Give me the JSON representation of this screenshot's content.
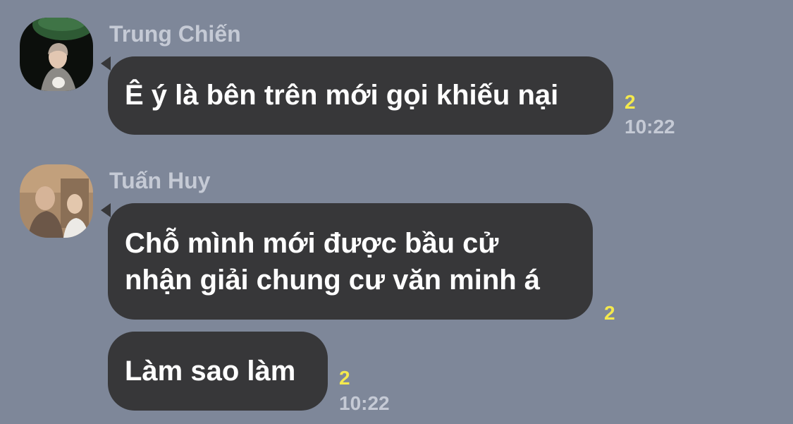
{
  "theme": {
    "background": "#7e8799",
    "bubble": "#373739",
    "bubble_text": "#ffffff",
    "sender_name": "#c5cad5",
    "unread_count": "#f4e94d",
    "timestamp": "#c5cad5"
  },
  "messages": [
    {
      "sender": "Trung Chiến",
      "avatar": "trung-chien-avatar",
      "text": "Ê ý là bên trên mới gọi khiếu nại",
      "unread": "2",
      "time": "10:22"
    },
    {
      "sender": "Tuấn Huy",
      "avatar": "tuan-huy-avatar",
      "text_line1": "Chỗ mình mới được bầu cử",
      "text_line2": "nhận giải chung cư văn minh á",
      "unread": "2",
      "time": ""
    },
    {
      "sender": "",
      "text": "Làm sao làm",
      "unread": "2",
      "time": "10:22"
    }
  ]
}
